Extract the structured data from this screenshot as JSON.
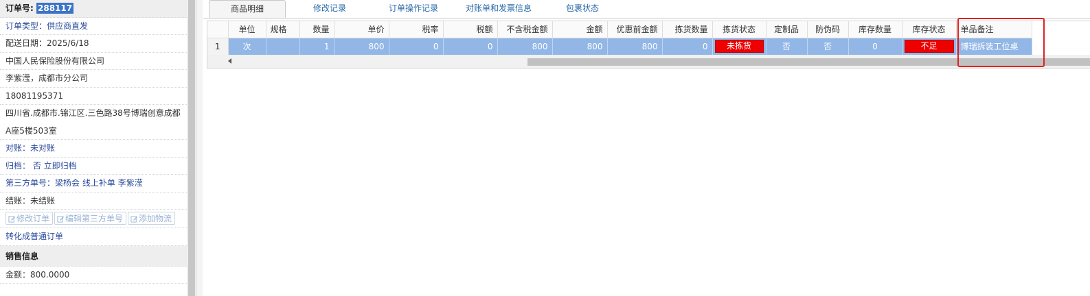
{
  "order": {
    "order_no_label": "订单号:",
    "order_no_value": "288117",
    "order_type": "订单类型：供应商直发",
    "delivery_date": "配送日期：2025/6/18",
    "company": "中国人民保险股份有限公司",
    "contact": "李紫滢，成都市分公司",
    "phone": "18081195371",
    "address_line1": "四川省.成都市.锦江区.三色路38号博瑞创意成都",
    "address_line2": "A座5楼503室",
    "reconcile": "对账：未对账",
    "archive": "归档：  否 立即归档",
    "third_party": "第三方单号：梁杨会 线上补单 李紫滢",
    "settlement": "结账：未结账",
    "buttons": {
      "edit_order": "修改订单",
      "edit_third_party": "编辑第三方单号",
      "add_logistics": "添加物流"
    },
    "convert_link": "转化成普通订单",
    "sales_header": "销售信息",
    "amount": "金额：800.0000"
  },
  "tabs": [
    {
      "label": "商品明细",
      "active": true
    },
    {
      "label": "修改记录",
      "active": false
    },
    {
      "label": "订单操作记录",
      "active": false
    },
    {
      "label": "对账单和发票信息",
      "active": false
    },
    {
      "label": "包裹状态",
      "active": false
    }
  ],
  "table": {
    "columns": [
      "单位",
      "规格",
      "数量",
      "单价",
      "税率",
      "税额",
      "不含税金额",
      "金额",
      "优惠前金额",
      "拣货数量",
      "拣货状态",
      "定制品",
      "防伪码",
      "库存数量",
      "库存状态",
      "单品备注"
    ],
    "rows": [
      {
        "num": "1",
        "unit": "次",
        "spec": "",
        "qty": "1",
        "price": "800",
        "tax_rate": "0",
        "tax": "0",
        "amount_ex_tax": "800",
        "amount": "800",
        "amount_before_discount": "800",
        "pick_qty": "0",
        "pick_status": "未拣货",
        "custom": "否",
        "anti_fake": "否",
        "stock_qty": "0",
        "stock_status": "不足",
        "remark": "博瑞拆装工位桌"
      }
    ]
  },
  "colors": {
    "selected_row": "#92b6e6",
    "status_red": "#ee0000",
    "highlight_border": "#e02020",
    "link_blue": "#2a4a9c",
    "tab_blue": "#2a6aa8"
  }
}
